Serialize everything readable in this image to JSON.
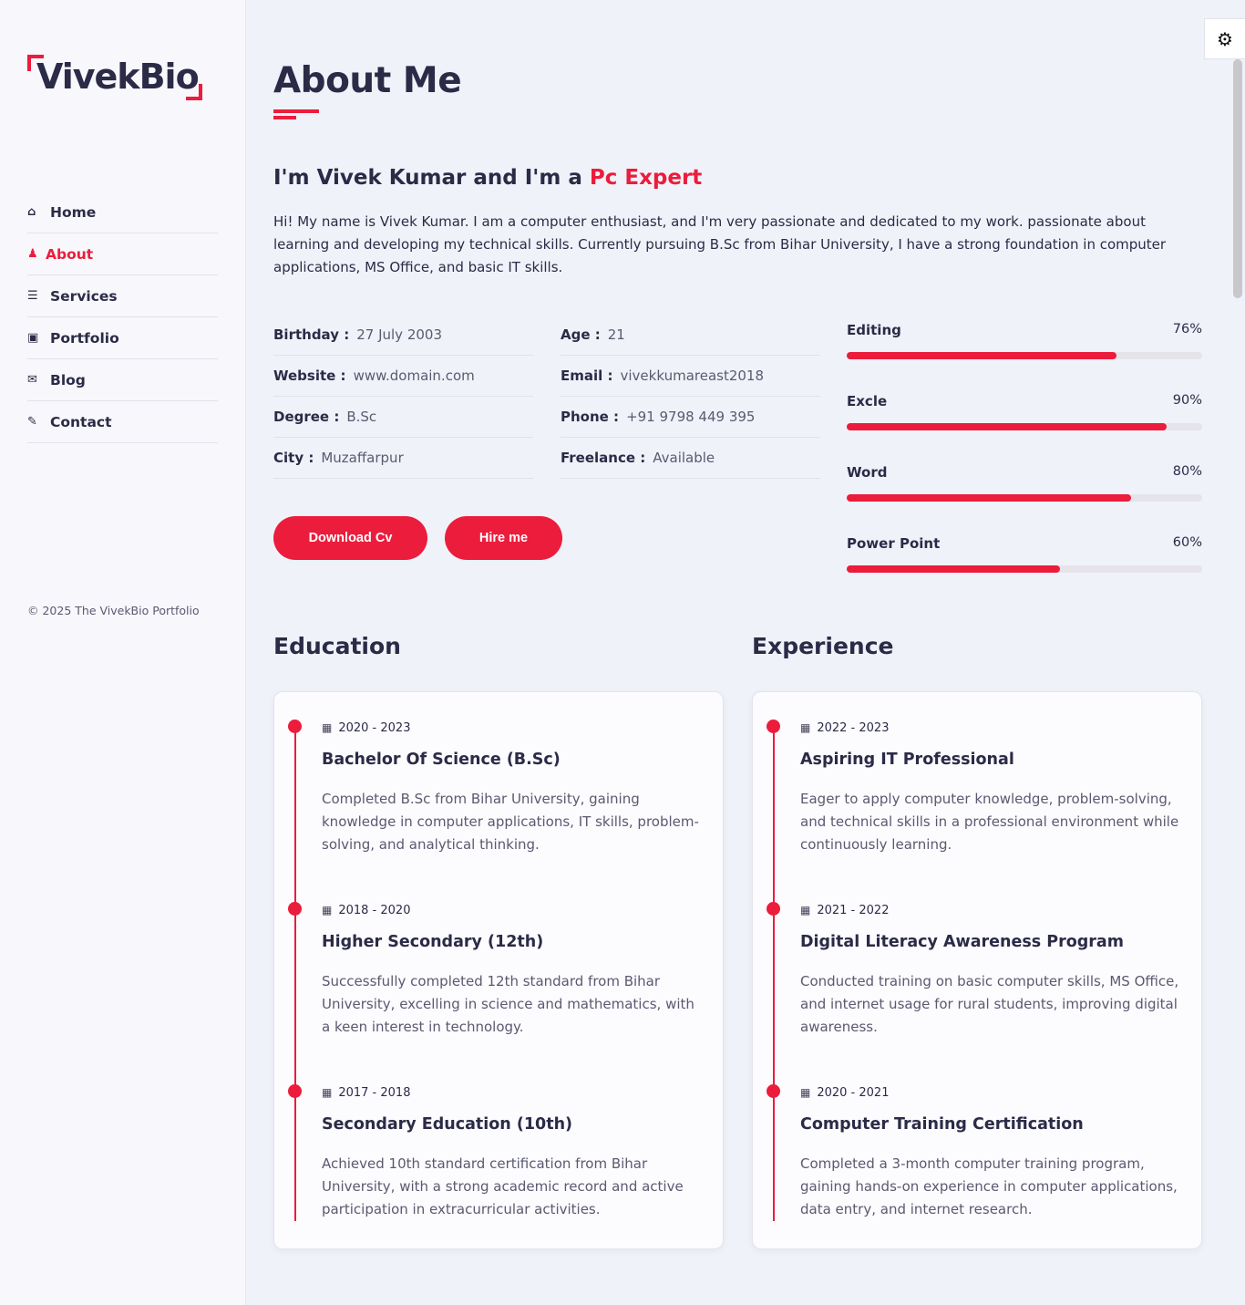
{
  "brand": {
    "logo_text": "VivekBio",
    "accent_color": "#ec1c3c"
  },
  "sidebar": {
    "items": [
      {
        "label": "Home",
        "icon": "home-icon",
        "glyph": "⌂"
      },
      {
        "label": "About",
        "icon": "user-icon",
        "glyph": "♟"
      },
      {
        "label": "Services",
        "icon": "list-icon",
        "glyph": "☰"
      },
      {
        "label": "Portfolio",
        "icon": "briefcase-icon",
        "glyph": "▣"
      },
      {
        "label": "Blog",
        "icon": "envelope-icon",
        "glyph": "✉"
      },
      {
        "label": "Contact",
        "icon": "comments-icon",
        "glyph": "✎"
      }
    ],
    "active_index": 1,
    "copyright": "© 2025 The VivekBio Portfolio"
  },
  "settings": {
    "icon": "gear-icon",
    "glyph": "⚙"
  },
  "about": {
    "title": "About Me",
    "heading_prefix": "I'm Vivek Kumar and I'm a",
    "heading_accent": "Pc Expert",
    "intro": "Hi! My name is Vivek Kumar. I am a computer enthusiast, and I'm very passionate and dedicated to my work. passionate about learning and developing my technical skills. Currently pursuing B.Sc from Bihar University, I have a strong foundation in computer applications, MS Office, and basic IT skills.",
    "info_left": [
      {
        "key": "Birthday :",
        "value": "27 July 2003"
      },
      {
        "key": "Website :",
        "value": "www.domain.com"
      },
      {
        "key": "Degree :",
        "value": "B.Sc"
      },
      {
        "key": "City :",
        "value": "Muzaffarpur"
      }
    ],
    "info_right": [
      {
        "key": "Age :",
        "value": "21"
      },
      {
        "key": "Email :",
        "value": "vivekkumareast2018"
      },
      {
        "key": "Phone :",
        "value": "+91 9798 449 395"
      },
      {
        "key": "Freelance :",
        "value": "Available"
      }
    ],
    "skills": [
      {
        "name": "Editing",
        "percent_label": "76%",
        "percent": 76
      },
      {
        "name": "Excle",
        "percent_label": "90%",
        "percent": 90
      },
      {
        "name": "Word",
        "percent_label": "80%",
        "percent": 80
      },
      {
        "name": "Power Point",
        "percent_label": "60%",
        "percent": 60
      }
    ],
    "download_label": "Download Cv",
    "hire_label": "Hire me"
  },
  "education": {
    "title": "Education",
    "items": [
      {
        "date": "2020 - 2023",
        "title": "Bachelor Of Science (B.Sc)",
        "desc": "Completed B.Sc from Bihar University, gaining knowledge in computer applications, IT skills, problem-solving, and analytical thinking."
      },
      {
        "date": "2018 - 2020",
        "title": "Higher Secondary (12th)",
        "desc": "Successfully completed 12th standard from Bihar University, excelling in science and mathematics, with a keen interest in technology."
      },
      {
        "date": "2017 - 2018",
        "title": "Secondary Education (10th)",
        "desc": "Achieved 10th standard certification from Bihar University, with a strong academic record and active participation in extracurricular activities."
      }
    ]
  },
  "experience": {
    "title": "Experience",
    "items": [
      {
        "date": "2022 - 2023",
        "title": "Aspiring IT Professional",
        "desc": "Eager to apply computer knowledge, problem-solving, and technical skills in a professional environment while continuously learning."
      },
      {
        "date": "2021 - 2022",
        "title": "Digital Literacy Awareness Program",
        "desc": "Conducted training on basic computer skills, MS Office, and internet usage for rural students, improving digital awareness."
      },
      {
        "date": "2020 - 2021",
        "title": "Computer Training Certification",
        "desc": "Completed a 3-month computer training program, gaining hands-on experience in computer applications, data entry, and internet research."
      }
    ]
  },
  "calendar_glyph": "▦"
}
